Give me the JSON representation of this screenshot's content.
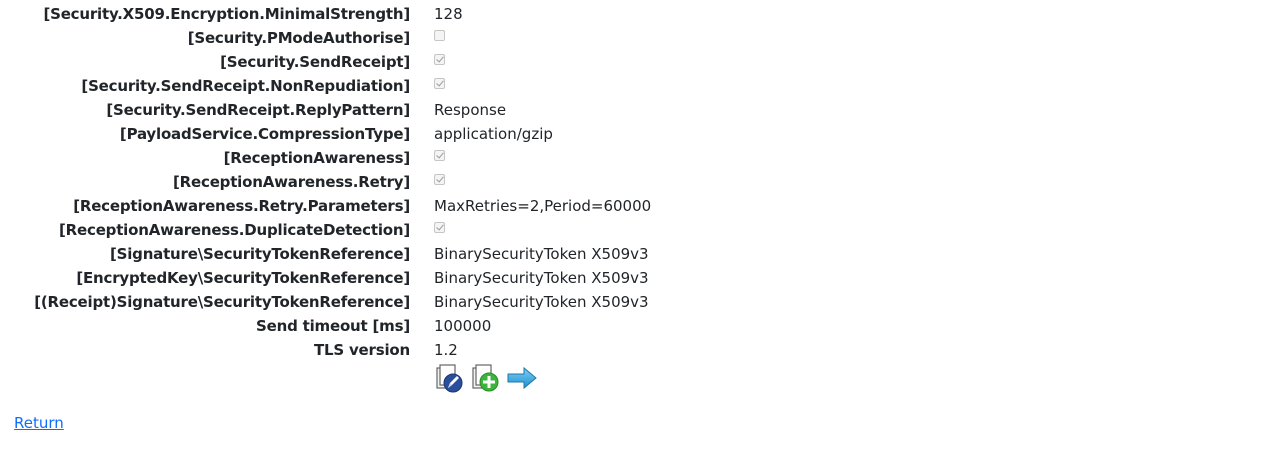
{
  "properties": [
    {
      "label": "[Security.X509.Encryption.MinimalStrength]",
      "type": "text",
      "value": "128"
    },
    {
      "label": "[Security.PModeAuthorise]",
      "type": "checkbox",
      "checked": false
    },
    {
      "label": "[Security.SendReceipt]",
      "type": "checkbox",
      "checked": true
    },
    {
      "label": "[Security.SendReceipt.NonRepudiation]",
      "type": "checkbox",
      "checked": true
    },
    {
      "label": "[Security.SendReceipt.ReplyPattern]",
      "type": "text",
      "value": "Response"
    },
    {
      "label": "[PayloadService.CompressionType]",
      "type": "text",
      "value": "application/gzip"
    },
    {
      "label": "[ReceptionAwareness]",
      "type": "checkbox",
      "checked": true
    },
    {
      "label": "[ReceptionAwareness.Retry]",
      "type": "checkbox",
      "checked": true
    },
    {
      "label": "[ReceptionAwareness.Retry.Parameters]",
      "type": "text",
      "value": "MaxRetries=2,Period=60000"
    },
    {
      "label": "[ReceptionAwareness.DuplicateDetection]",
      "type": "checkbox",
      "checked": true
    },
    {
      "label": "[Signature\\SecurityTokenReference]",
      "type": "text",
      "value": "BinarySecurityToken X509v3"
    },
    {
      "label": "[EncryptedKey\\SecurityTokenReference]",
      "type": "text",
      "value": "BinarySecurityToken X509v3"
    },
    {
      "label": "[(Receipt)Signature\\SecurityTokenReference]",
      "type": "text",
      "value": "BinarySecurityToken X509v3"
    },
    {
      "label": "Send timeout [ms]",
      "type": "text",
      "value": "100000"
    },
    {
      "label": "TLS version",
      "type": "text",
      "value": "1.2"
    }
  ],
  "actions": [
    {
      "name": "edit-icon",
      "color": "#2a4e9c"
    },
    {
      "name": "copy-add-icon",
      "color": "#3cb43c"
    },
    {
      "name": "arrow-right-icon",
      "color": "#2aa0d8"
    }
  ],
  "footer": {
    "return_label": "Return"
  }
}
